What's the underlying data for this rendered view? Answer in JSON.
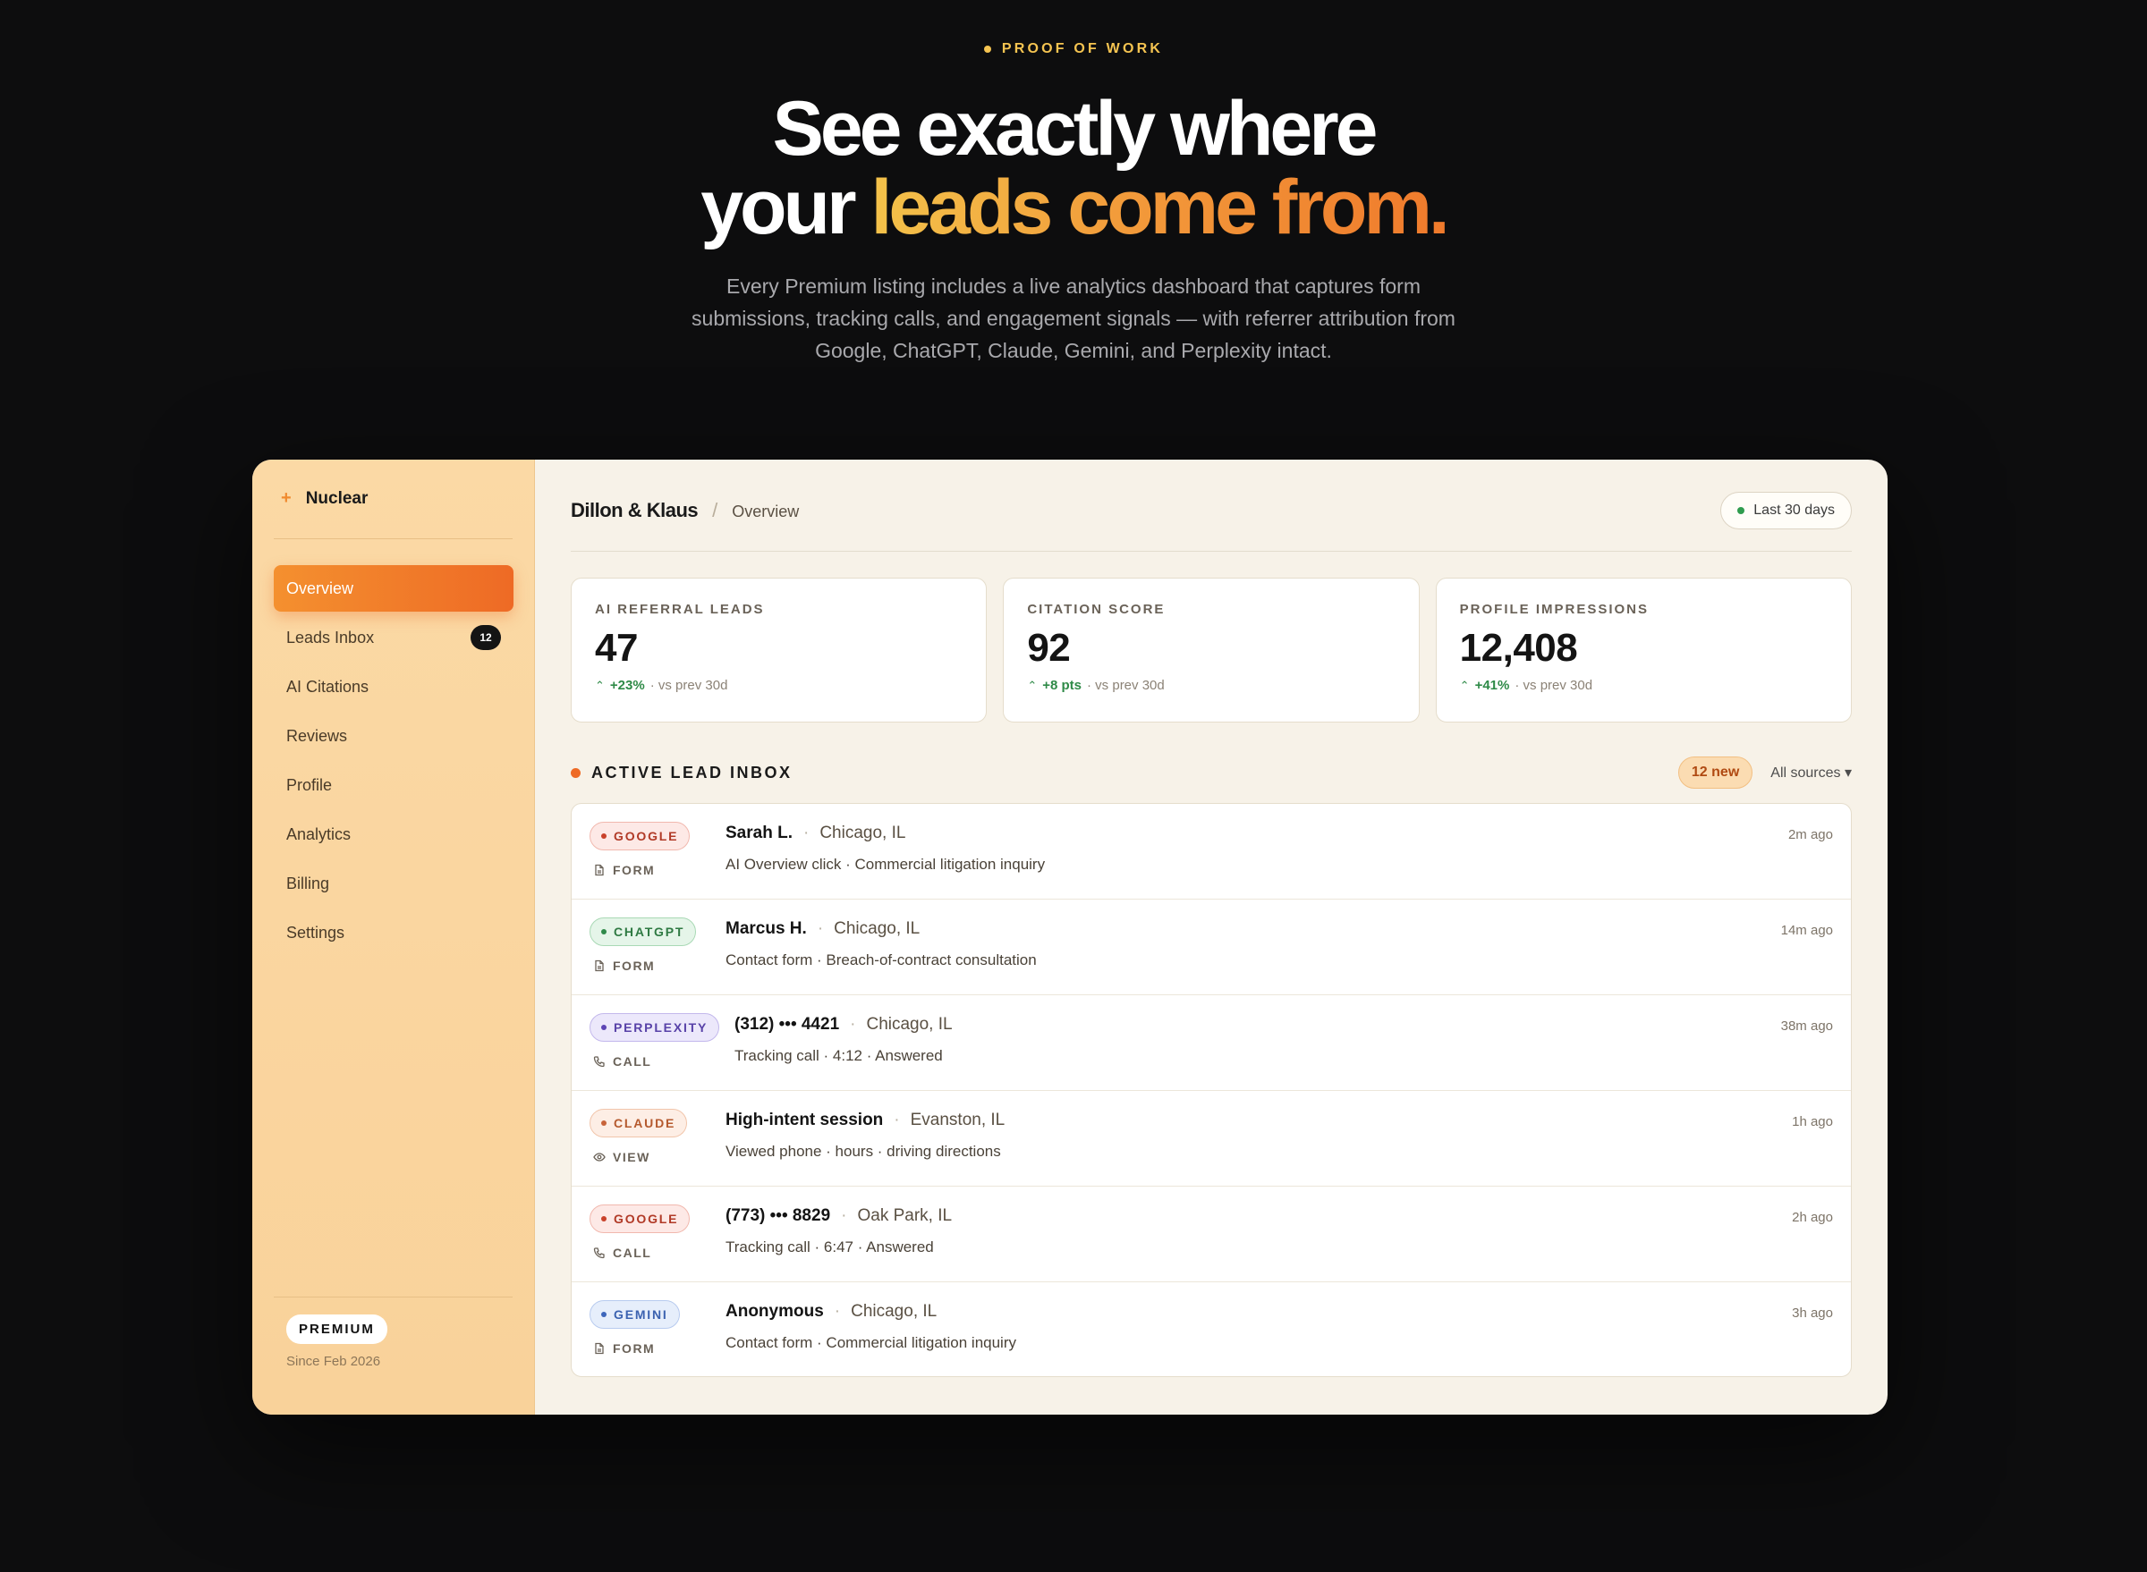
{
  "hero": {
    "eyebrow": "PROOF OF WORK",
    "headline_line1": "See exactly where",
    "headline_line2_plain": "your ",
    "headline_line2_accent": "leads come from.",
    "subcopy": "Every Premium listing includes a live analytics dashboard that captures form submissions, tracking calls, and engagement signals — with referrer attribution from Google, ChatGPT, Claude, Gemini, and Perplexity intact."
  },
  "sidebar": {
    "brand": "Nuclear",
    "brand_icon": "sparkle-icon",
    "items": [
      {
        "label": "Overview",
        "active": true
      },
      {
        "label": "Leads Inbox",
        "badge": "12"
      },
      {
        "label": "AI Citations"
      },
      {
        "label": "Reviews"
      },
      {
        "label": "Profile"
      },
      {
        "label": "Analytics"
      },
      {
        "label": "Billing"
      },
      {
        "label": "Settings"
      }
    ],
    "plan": "PREMIUM",
    "plan_since": "Since Feb 2026"
  },
  "header": {
    "client": "Dillon & Klaus",
    "separator": "/",
    "page": "Overview",
    "range": "Last 30 days"
  },
  "kpis": [
    {
      "label": "AI REFERRAL LEADS",
      "value": "47",
      "change": "+23%",
      "compare": "· vs prev 30d"
    },
    {
      "label": "CITATION SCORE",
      "value": "92",
      "change": "+8 pts",
      "compare": "· vs prev 30d"
    },
    {
      "label": "PROFILE IMPRESSIONS",
      "value": "12,408",
      "change": "+41%",
      "compare": "· vs prev 30d"
    }
  ],
  "inbox": {
    "title": "ACTIVE LEAD INBOX",
    "new_count": "12 new",
    "filter": "All sources ▾",
    "rows": [
      {
        "source": "GOOGLE",
        "type": "FORM",
        "name": "Sarah L.",
        "location": "Chicago, IL",
        "detail": "AI Overview click · Commercial litigation inquiry",
        "time": "2m ago"
      },
      {
        "source": "CHATGPT",
        "type": "FORM",
        "name": "Marcus H.",
        "location": "Chicago, IL",
        "detail": "Contact form · Breach-of-contract consultation",
        "time": "14m ago"
      },
      {
        "source": "PERPLEXITY",
        "type": "CALL",
        "name": "(312) ••• 4421",
        "location": "Chicago, IL",
        "detail": "Tracking call · 4:12 · Answered",
        "time": "38m ago"
      },
      {
        "source": "CLAUDE",
        "type": "VIEW",
        "name": "High-intent session",
        "location": "Evanston, IL",
        "detail": "Viewed phone · hours · driving directions",
        "time": "1h ago"
      },
      {
        "source": "GOOGLE",
        "type": "CALL",
        "name": "(773) ••• 8829",
        "location": "Oak Park, IL",
        "detail": "Tracking call · 6:47 · Answered",
        "time": "2h ago"
      },
      {
        "source": "GEMINI",
        "type": "FORM",
        "name": "Anonymous",
        "location": "Chicago, IL",
        "detail": "Contact form · Commercial litigation inquiry",
        "time": "3h ago"
      }
    ]
  },
  "colors": {
    "accent": "#ee6a25",
    "eyebrow": "#f5c451",
    "positive": "#2e8a47"
  }
}
